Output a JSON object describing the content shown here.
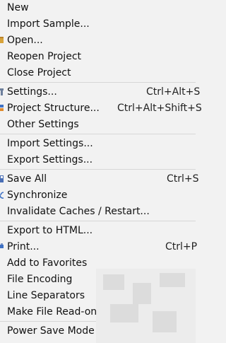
{
  "menu": {
    "items": [
      {
        "label": "New"
      },
      {
        "label": "Import Sample..."
      },
      {
        "label": "Open..."
      },
      {
        "label": "Reopen Project"
      },
      {
        "label": "Close Project"
      },
      {
        "label": "Settings...",
        "shortcut": "Ctrl+Alt+S"
      },
      {
        "label": "Project Structure...",
        "shortcut": "Ctrl+Alt+Shift+S"
      },
      {
        "label": "Other Settings"
      },
      {
        "label": "Import Settings..."
      },
      {
        "label": "Export Settings..."
      },
      {
        "label": "Save All",
        "shortcut": "Ctrl+S"
      },
      {
        "label": "Synchronize"
      },
      {
        "label": "Invalidate Caches / Restart..."
      },
      {
        "label": "Export to HTML..."
      },
      {
        "label": "Print...",
        "shortcut": "Ctrl+P"
      },
      {
        "label": "Add to Favorites"
      },
      {
        "label": "File Encoding"
      },
      {
        "label": "Line Separators"
      },
      {
        "label": "Make File Read-only"
      },
      {
        "label": "Power Save Mode"
      }
    ]
  },
  "icons": {
    "open": "folder-icon",
    "settings": "wrench-icon",
    "project_structure": "project-structure-icon",
    "save_all": "save-icon",
    "synchronize": "sync-icon",
    "print": "printer-icon"
  },
  "colors": {
    "background": "#f2f2f2",
    "separator": "#d7d7d7",
    "text": "#111111"
  }
}
